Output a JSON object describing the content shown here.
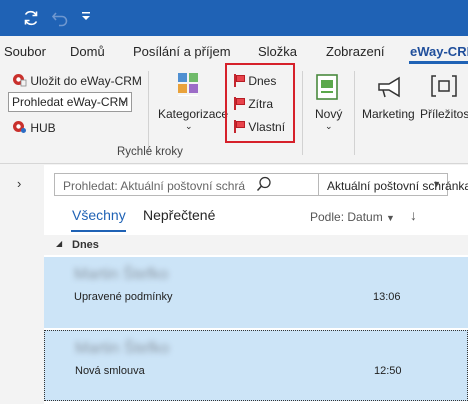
{
  "titlebar": {
    "icons": [
      "sync-icon",
      "undo-icon",
      "customize-qat-icon"
    ]
  },
  "tabs": [
    {
      "label": "Soubor"
    },
    {
      "label": "Domů"
    },
    {
      "label": "Posílání a příjem"
    },
    {
      "label": "Složka"
    },
    {
      "label": "Zobrazení"
    },
    {
      "label": "eWay-CRM"
    }
  ],
  "ribbon": {
    "eway": {
      "save_label": "Uložit do eWay-CRM",
      "search_value": "Prohledat eWay-CRM",
      "hub_label": "HUB"
    },
    "categorize_label": "Kategorizace",
    "flags": {
      "today": "Dnes",
      "tomorrow": "Zítra",
      "custom": "Vlastní"
    },
    "quick_steps_label": "Rychlé kroky",
    "new_label": "Nový",
    "marketing_label": "Marketing",
    "opportunities_label": "Příležitos"
  },
  "mail_list": {
    "search_placeholder": "Prohledat: Aktuální poštovní schrá",
    "scope_value": "Aktuální poštovní schránka",
    "filters": {
      "all": "Všechny",
      "unread": "Nepřečtené"
    },
    "sort_label": "Podle: Datum",
    "group_label": "Dnes",
    "messages": [
      {
        "sender": "Martin Štefko",
        "subject": "Upravené podmínky",
        "time": "13:06"
      },
      {
        "sender": "Martin Štefko",
        "subject": "Nová smlouva",
        "time": "12:50"
      }
    ]
  },
  "colors": {
    "titlebar": "#1f62b5",
    "accent": "#1f62b5",
    "highlight_box": "#d6202a",
    "selected_row": "#cce4f7"
  }
}
